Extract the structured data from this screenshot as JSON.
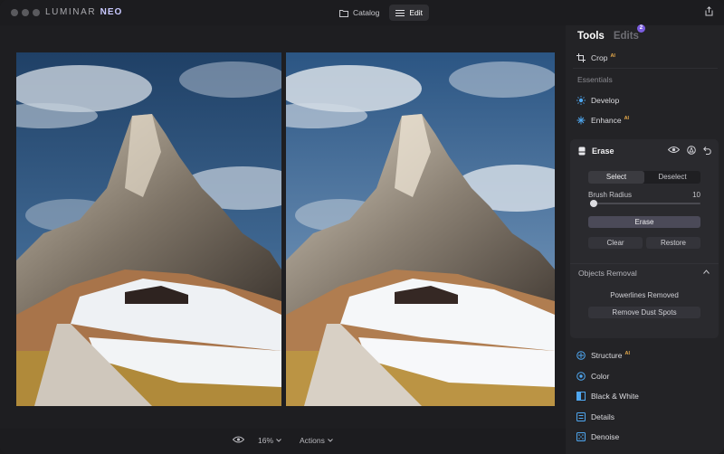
{
  "app": {
    "logo_main": "LUMINAR",
    "logo_accent": "NEO"
  },
  "topnav": {
    "catalog_label": "Catalog",
    "edit_label": "Edit"
  },
  "bottombar": {
    "zoom_label": "16%",
    "actions_label": "Actions"
  },
  "panel": {
    "tabs": {
      "tools": "Tools",
      "edits": "Edits",
      "edits_count": "2"
    },
    "crop_label": "Crop",
    "ai_badge": "AI",
    "essentials_label": "Essentials",
    "develop_label": "Develop",
    "enhance_label": "Enhance",
    "erase": {
      "title": "Erase",
      "select_label": "Select",
      "deselect_label": "Deselect",
      "brush_radius_label": "Brush Radius",
      "brush_radius_value": "10",
      "brush_radius_fraction": 0.03,
      "erase_button": "Erase",
      "clear_button": "Clear",
      "restore_button": "Restore",
      "objects_removal_label": "Objects Removal",
      "powerlines_text": "Powerlines Removed",
      "remove_dust_button": "Remove Dust Spots"
    },
    "tools_list": {
      "structure": "Structure",
      "color": "Color",
      "black_white": "Black & White",
      "details": "Details",
      "denoise": "Denoise"
    }
  },
  "colors": {
    "accent_purple": "#7b5de0",
    "ai_orange": "#e3a84a",
    "develop_blue": "#4fa7f0",
    "enhance_blue": "#4fa7f0"
  }
}
